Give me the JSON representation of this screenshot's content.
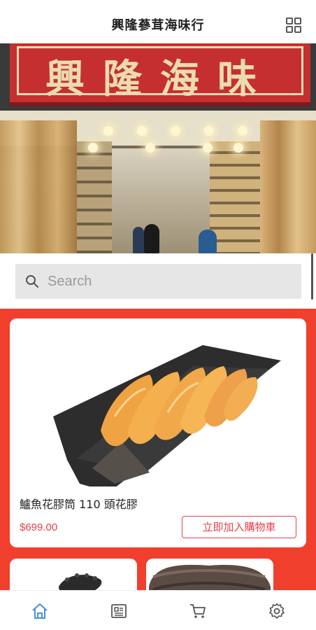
{
  "header": {
    "title": "興隆蔘茸海味行",
    "menu_icon": "grid-icon"
  },
  "banner": {
    "sign_text": "興隆海味",
    "image": "shop-storefront-photo"
  },
  "search": {
    "placeholder": "Search",
    "value": "",
    "icon": "search-icon"
  },
  "products": {
    "featured": {
      "name": "鱸魚花膠筒 110 頭花膠",
      "price": "$699.00",
      "add_to_cart_label": "立即加入購物車"
    },
    "thumbnails": [
      {
        "image": "sea-cucumber-photo"
      },
      {
        "image": "dried-sea-cucumber-photo"
      }
    ]
  },
  "bottom_nav": {
    "items": [
      {
        "name": "home",
        "icon": "home-icon",
        "active": true
      },
      {
        "name": "articles",
        "icon": "article-icon",
        "active": false
      },
      {
        "name": "cart",
        "icon": "cart-icon",
        "active": false
      },
      {
        "name": "settings",
        "icon": "gear-icon",
        "active": false
      }
    ]
  },
  "colors": {
    "accent_red": "#f0402d",
    "price_red": "#e8404a",
    "active_nav": "#4a8fe0",
    "inactive_nav": "#555555"
  }
}
